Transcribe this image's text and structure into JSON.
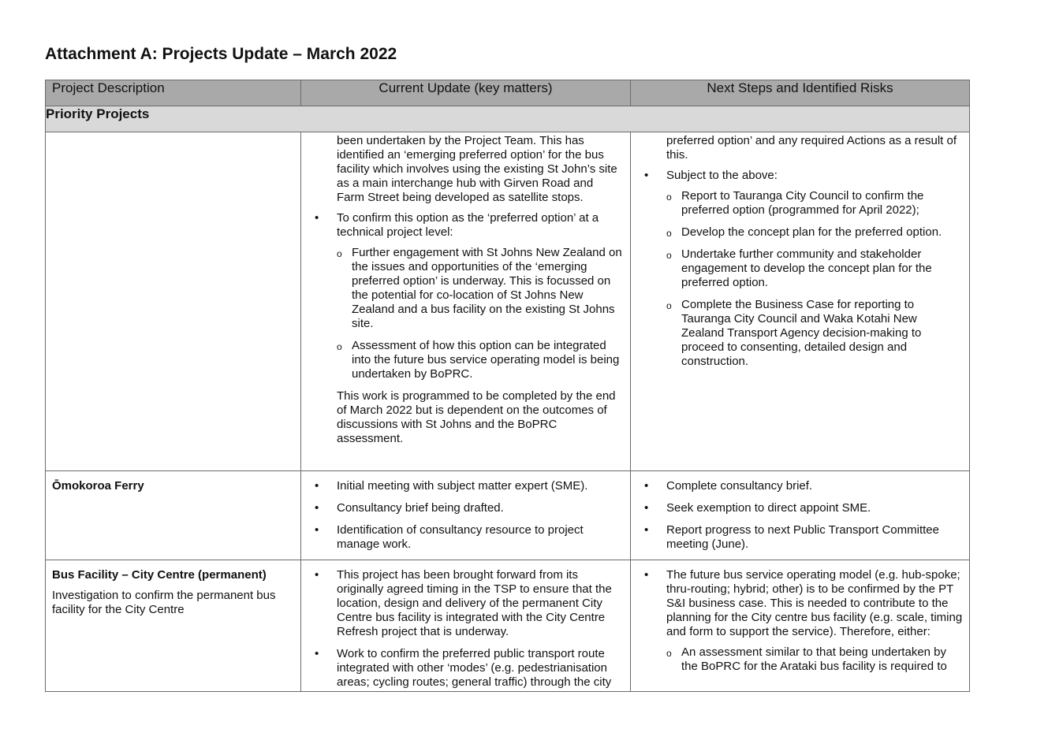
{
  "title": "Attachment A: Projects Update – March 2022",
  "columns": [
    "Project Description",
    "Current Update (key matters)",
    "Next Steps and Identified Risks"
  ],
  "section": "Priority Projects",
  "row1": {
    "update": {
      "cont": "been undertaken by the Project Team. This has identified an ‘emerging preferred option’ for the bus facility which involves using the existing St John’s site as a main interchange hub with Girven Road and Farm Street being developed as satellite stops.",
      "bullet": "To confirm this option as the ‘preferred option’ at a technical project level:",
      "subs": [
        "Further engagement with St Johns New Zealand on the issues and opportunities of the ‘emerging preferred option’ is underway. This is focussed on the potential for co-location of St Johns New Zealand and a bus facility on the existing St Johns site.",
        "Assessment of how this option can be integrated into the future bus service operating model is being undertaken by BoPRC."
      ],
      "para": "This work is programmed to be completed by the end of March 2022 but is dependent on the outcomes of discussions with St Johns and the BoPRC assessment."
    },
    "next": {
      "cont": "preferred option’ and any required Actions as a result of this.",
      "bullet": "Subject to the above:",
      "subs": [
        "Report to Tauranga City Council to confirm the preferred option (programmed for April 2022);",
        "Develop the concept plan for the preferred option.",
        "Undertake further community and stakeholder engagement to develop the concept plan for the preferred option.",
        "Complete the Business Case for reporting to Tauranga City Council and Waka Kotahi New Zealand Transport Agency decision-making to proceed to consenting, detailed design and construction."
      ]
    }
  },
  "row2": {
    "desc": "Ōmokoroa Ferry",
    "update": [
      "Initial meeting with subject matter expert (SME).",
      "Consultancy brief being drafted.",
      "Identification of consultancy resource to project manage work."
    ],
    "next": [
      "Complete consultancy brief.",
      "Seek exemption to direct appoint SME.",
      "Report progress to next Public Transport Committee meeting (June)."
    ]
  },
  "row3": {
    "desc_title": "Bus Facility – City Centre (permanent)",
    "desc_body": "Investigation to confirm the permanent bus facility for the City Centre",
    "update": [
      "This project has been brought forward from its originally agreed timing in the TSP to ensure that the location, design and delivery of the permanent City Centre bus facility is integrated with the City Centre Refresh project that is underway.",
      "Work to confirm the preferred public transport route integrated with other ‘modes’ (e.g. pedestrianisation areas; cycling routes; general traffic) through the city"
    ],
    "next": {
      "bullet": "The future bus service operating model (e.g. hub-spoke; thru-routing; hybrid; other) is to be confirmed by the PT S&I business case. This is needed to contribute to the planning for the City centre bus facility (e.g. scale, timing and form to support the service). Therefore, either:",
      "subs": [
        "An assessment similar to that being undertaken by the BoPRC for the Arataki bus facility is required to"
      ]
    }
  }
}
